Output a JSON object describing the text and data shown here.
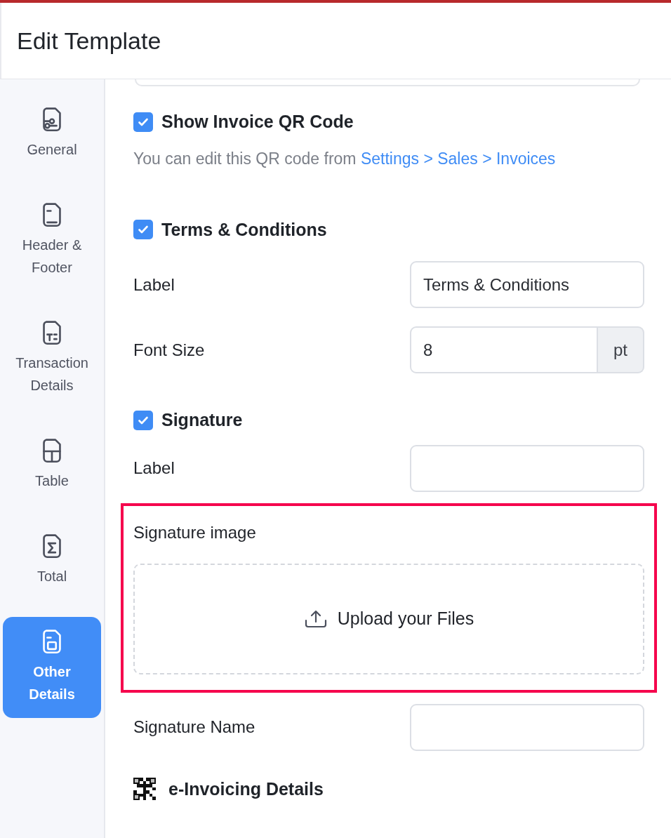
{
  "header": {
    "title": "Edit Template"
  },
  "sidebar": {
    "items": [
      {
        "label": "General",
        "selected": false
      },
      {
        "label": "Header & Footer",
        "selected": false
      },
      {
        "label": "Transaction Details",
        "selected": false
      },
      {
        "label": "Table",
        "selected": false
      },
      {
        "label": "Total",
        "selected": false
      },
      {
        "label": "Other Details",
        "selected": true
      }
    ]
  },
  "qr_code": {
    "checked": true,
    "title": "Show Invoice QR Code",
    "note": "You can edit this QR code from",
    "link": "Settings > Sales > Invoices"
  },
  "terms": {
    "checked": true,
    "title": "Terms & Conditions",
    "label_field": {
      "label": "Label",
      "value": "Terms & Conditions"
    },
    "font_size": {
      "label": "Font Size",
      "value": "8",
      "unit": "pt"
    }
  },
  "signature": {
    "checked": true,
    "title": "Signature",
    "label_field": {
      "label": "Label"
    },
    "image": {
      "label": "Signature image",
      "upload": "Upload your Files",
      "highlighted": true
    },
    "name_field": {
      "label": "Signature Name"
    }
  },
  "e_invoicing": {
    "title": "e-Invoicing Details"
  }
}
